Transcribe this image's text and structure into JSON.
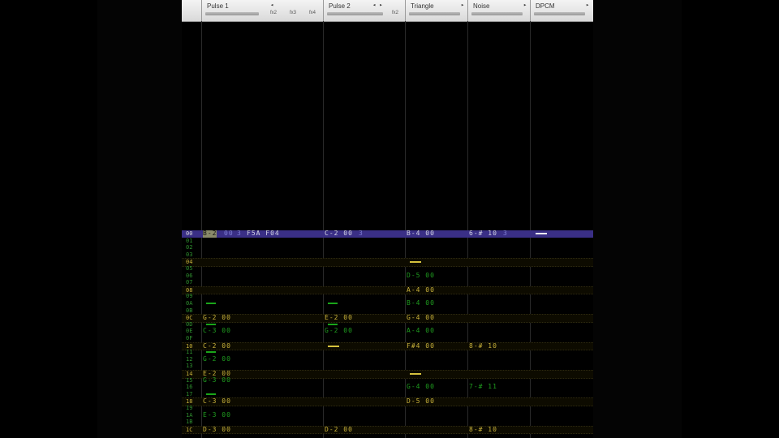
{
  "channels": [
    {
      "name": "Pulse 1",
      "arrow": "◂",
      "fx": [
        "fx2",
        "fx3",
        "fx4"
      ]
    },
    {
      "name": "Pulse 2",
      "arrow": "◂ ▸",
      "fx": [
        "fx2"
      ]
    },
    {
      "name": "Triangle",
      "arrow": "▸",
      "fx": []
    },
    {
      "name": "Noise",
      "arrow": "▸",
      "fx": []
    },
    {
      "name": "DPCM",
      "arrow": "▸",
      "fx": []
    }
  ],
  "rows": {
    "r00": "00",
    "r01": "01",
    "r02": "02",
    "r03": "03",
    "r04": "04",
    "r05": "05",
    "r06": "06",
    "r07": "07",
    "r08": "08",
    "r09": "09",
    "r0A": "0A",
    "r0B": "0B",
    "r0C": "0C",
    "r0D": "0D",
    "r0E": "0E",
    "r0F": "0F",
    "r10": "10",
    "r11": "11",
    "r12": "12",
    "r13": "13",
    "r14": "14",
    "r15": "15",
    "r16": "16",
    "r17": "17",
    "r18": "18",
    "r19": "19",
    "r1A": "1A",
    "r1B": "1B",
    "r1C": "1C"
  },
  "cells": {
    "p1_00_note": "B-2",
    "p1_00_inst": "00",
    "p1_00_vol": "3",
    "p1_00_fx": "F5A F04",
    "p2_00": "C-2 00",
    "p2_00_vol": "3",
    "tr_00": "B-4 00",
    "no_00": "6-# 10",
    "no_00_vol": "3",
    "tr_06": "D-5 00",
    "tr_08": "A-4 00",
    "tr_0A": "B-4 00",
    "p1_0C": "G-2 00",
    "p2_0C": "E-2 00",
    "tr_0C": "G-4 00",
    "p1_0E": "C-3 00",
    "p2_0E": "G-2 00",
    "tr_0E": "A-4 00",
    "p1_10": "C-2 00",
    "tr_10": "F#4 00",
    "no_10": "8-# 10",
    "p1_12": "G-2 00",
    "p1_14": "E-2 00",
    "p1_15": "G-3 00",
    "tr_16": "G-4 00",
    "no_16": "7-# 11",
    "p1_18": "C-3 00",
    "tr_18": "D-5 00",
    "p1_1A": "E-3 00",
    "p1_1C": "D-3 00",
    "p2_1C": "D-2 00",
    "no_1C": "8-# 10"
  },
  "colors": {
    "cursor": "#3a2f86",
    "note_green": "#1f9d1f",
    "note_yellow": "#c9b23a",
    "header": "#e6e6e6"
  }
}
